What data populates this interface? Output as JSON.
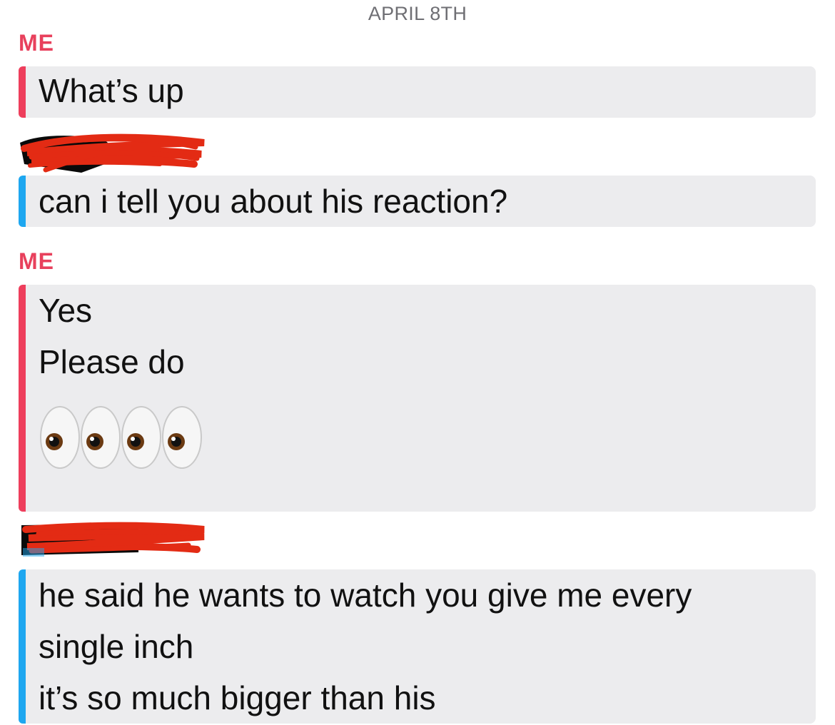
{
  "date_header": "APRIL 8TH",
  "messages": [
    {
      "sender": "ME",
      "lines": [
        "What’s up"
      ]
    },
    {
      "sender_redacted": true,
      "lines": [
        "can i tell you about his reaction?"
      ]
    },
    {
      "sender": "ME",
      "lines": [
        "Yes",
        "Please do"
      ],
      "emoji": [
        "eyes-icon",
        "eyes-icon",
        "eyes-icon",
        "eyes-icon"
      ]
    },
    {
      "sender_redacted": true,
      "lines": [
        "he said he wants to watch you give me every",
        "single inch",
        "it’s so much bigger than his"
      ]
    }
  ],
  "colors": {
    "me_accent": "#e8405c",
    "them_accent": "#1ea7f0",
    "bubble_bg": "#ececee",
    "redaction": "#e32b14"
  }
}
